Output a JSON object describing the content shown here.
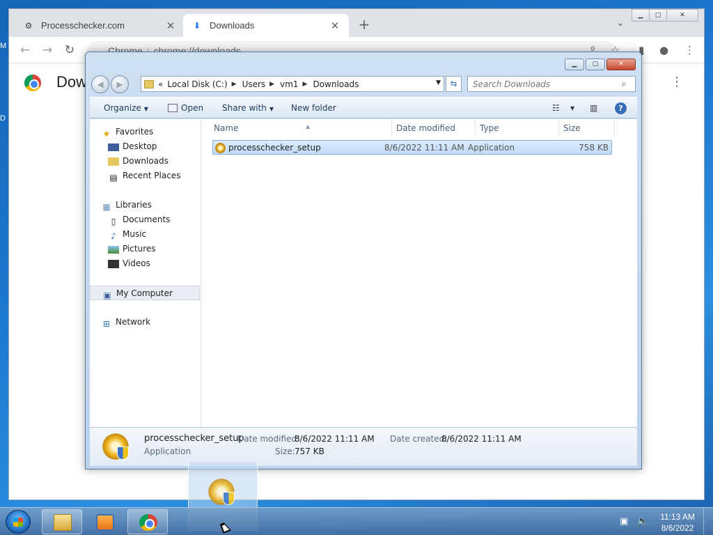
{
  "desktop": {
    "edge_labels": [
      "M",
      "D"
    ]
  },
  "chrome": {
    "tabs": [
      {
        "title": "Processchecker.com",
        "icon": "settings-favicon"
      },
      {
        "title": "Downloads",
        "icon": "download-icon"
      }
    ],
    "new_tab": "+",
    "tab_search": "⌄",
    "omnibox": {
      "site_label": "Chrome",
      "url": "chrome://downloads"
    },
    "page_title": "Dow",
    "window_controls": [
      "▁",
      "▢",
      "✕"
    ]
  },
  "explorer": {
    "window_controls": [
      "▁",
      "▢",
      "✕"
    ],
    "address_path": [
      "Local Disk (C:)",
      "Users",
      "vm1",
      "Downloads"
    ],
    "address_prefix": "«",
    "search_placeholder": "Search Downloads",
    "commands": {
      "organize": "Organize",
      "open": "Open",
      "share_with": "Share with",
      "new_folder": "New folder"
    },
    "help": "?",
    "nav": {
      "favorites": {
        "label": "Favorites",
        "items": [
          "Desktop",
          "Downloads",
          "Recent Places"
        ]
      },
      "libraries": {
        "label": "Libraries",
        "items": [
          "Documents",
          "Music",
          "Pictures",
          "Videos"
        ]
      },
      "computer": "My Computer",
      "network": "Network"
    },
    "columns": [
      "Name",
      "Date modified",
      "Type",
      "Size"
    ],
    "files": [
      {
        "name": "processchecker_setup",
        "date_modified": "8/6/2022 11:11 AM",
        "type": "Application",
        "size": "758 KB"
      }
    ],
    "details": {
      "name": "processchecker_setup",
      "type": "Application",
      "date_modified_label": "Date modified:",
      "date_modified": "8/6/2022 11:11 AM",
      "size_label": "Size:",
      "size": "757 KB",
      "date_created_label": "Date created:",
      "date_created": "8/6/2022 11:11 AM"
    }
  },
  "taskbar": {
    "clock_time": "11:13 AM",
    "clock_date": "8/6/2022"
  },
  "colors": {
    "selection": "#c3dcf8",
    "taskbar": "#466ea0",
    "accent": "#3b6db6"
  }
}
